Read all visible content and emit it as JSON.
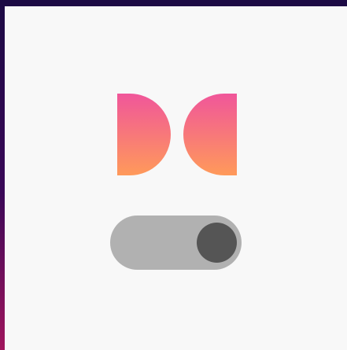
{
  "app": {
    "logo": {
      "icon": "half-circles-logo",
      "gradient_top": "#f0569a",
      "gradient_bottom": "#ff9a5a"
    },
    "toggle": {
      "state": "on",
      "track_color": "#b1b1b1",
      "knob_color": "#555555"
    },
    "colors": {
      "panel_background": "#f8f8f8",
      "frame_top": "#1c0a44",
      "frame_bottom": "#a0155c"
    }
  }
}
